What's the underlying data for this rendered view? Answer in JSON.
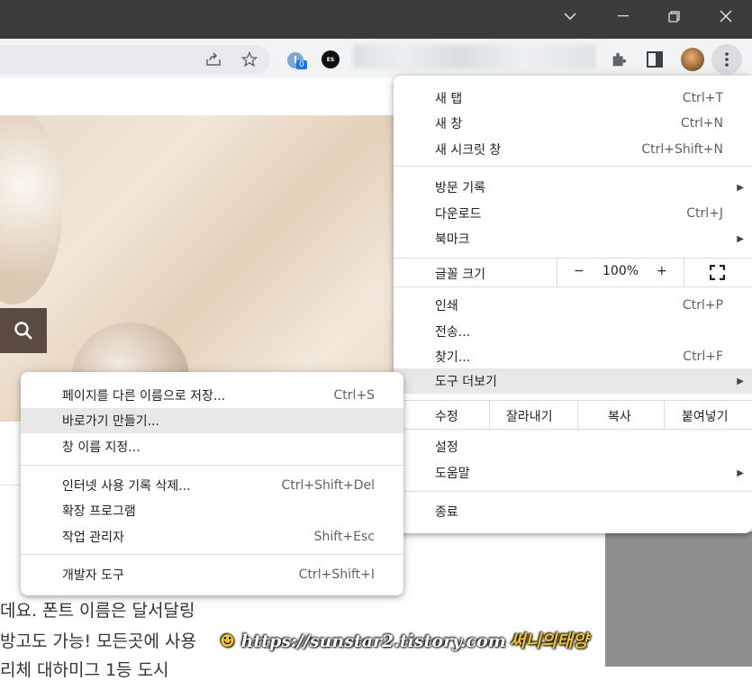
{
  "window": {
    "minimize_label": "—",
    "maximize_label": "❐",
    "close_label": "✕"
  },
  "toolbar": {
    "extension_badge": "0",
    "extension_es": "ES"
  },
  "main_menu": {
    "items": [
      {
        "label": "새 탭",
        "shortcut": "Ctrl+T"
      },
      {
        "label": "새 창",
        "shortcut": "Ctrl+N"
      },
      {
        "label": "새 시크릿 창",
        "shortcut": "Ctrl+Shift+N"
      },
      {
        "label": "방문 기록",
        "arrow": "▶"
      },
      {
        "label": "다운로드",
        "shortcut": "Ctrl+J"
      },
      {
        "label": "북마크",
        "arrow": "▶"
      }
    ],
    "zoom": {
      "label": "글꼴 크기",
      "minus": "−",
      "value": "100%",
      "plus": "+"
    },
    "items2": [
      {
        "label": "인쇄",
        "shortcut": "Ctrl+P"
      },
      {
        "label": "전송..."
      },
      {
        "label": "찾기...",
        "shortcut": "Ctrl+F"
      },
      {
        "label": "도구 더보기",
        "arrow": "▶"
      }
    ],
    "edit": {
      "label": "수정",
      "cut": "잘라내기",
      "copy": "복사",
      "paste": "붙여넣기"
    },
    "items3": [
      {
        "label": "설정"
      },
      {
        "label": "도움말",
        "arrow": "▶"
      }
    ],
    "exit": "종료"
  },
  "sub_menu": {
    "items": [
      {
        "label": "페이지를 다른 이름으로 저장...",
        "shortcut": "Ctrl+S"
      },
      {
        "label": "바로가기 만들기..."
      },
      {
        "label": "창 이름 지정..."
      },
      {
        "label": "인터넷 사용 기록 삭제...",
        "shortcut": "Ctrl+Shift+Del"
      },
      {
        "label": "확장 프로그램"
      },
      {
        "label": "작업 관리자",
        "shortcut": "Shift+Esc"
      },
      {
        "label": "개발자 도구",
        "shortcut": "Ctrl+Shift+I"
      }
    ]
  },
  "article": {
    "line1": "데요. 폰트 이름은 달서달링",
    "line2": "방고도 가능! 모든곳에 사용",
    "line3": "리체 대하미그 1등 도시"
  },
  "watermark": {
    "url": "https://sunstar2.tistory.com",
    "korean": "써니의태양"
  },
  "colors": {
    "titlebar": "#3c3c3c",
    "toolbar": "#f1f3f4",
    "menu_highlight": "#e8e8e8"
  }
}
